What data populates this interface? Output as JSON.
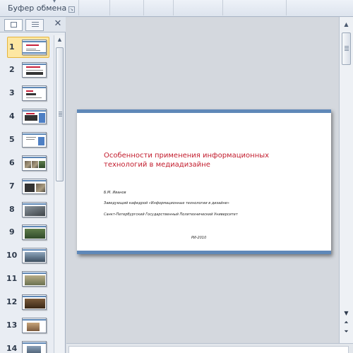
{
  "ribbon": {
    "clipboard_group_label": "Буфер обмена",
    "launcher_icon": "dialog-launcher-icon"
  },
  "left_pane": {
    "tabs": [
      {
        "name": "slides-tab",
        "icon": "slides-icon",
        "active": true
      },
      {
        "name": "outline-tab",
        "icon": "outline-icon",
        "active": false
      }
    ],
    "close_glyph": "✕",
    "selected_slide": 1,
    "slides": [
      "1",
      "2",
      "3",
      "4",
      "5",
      "6",
      "7",
      "8",
      "9",
      "10",
      "11",
      "12",
      "13",
      "14"
    ]
  },
  "slide": {
    "title": "Особенности применения информационных технологий в медиадизайне",
    "author": "Б.М. Иванов",
    "position": "Заведующий кафедрой «Информационные технологии в дизайне»",
    "university": "Санкт-Петербургский Государственный Политехнический Университет",
    "footer": "РИ-2010"
  },
  "colors": {
    "accent_band": "#5f88b8",
    "title_red": "#c21b2c",
    "selection": "#fde7a2"
  }
}
